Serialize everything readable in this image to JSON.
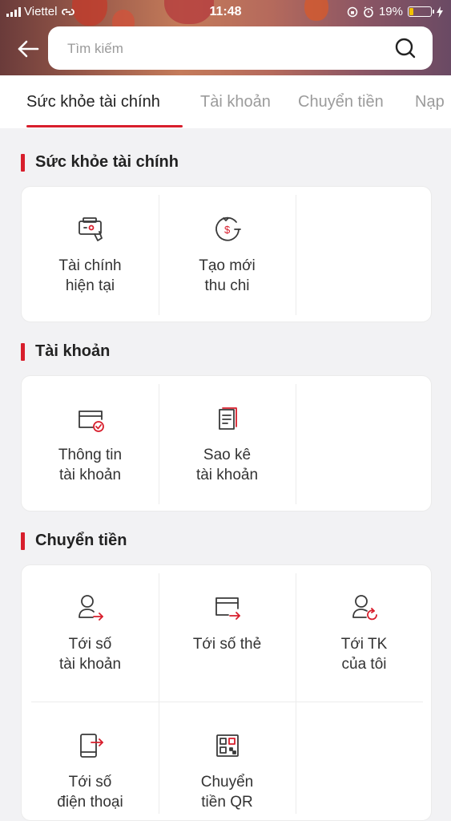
{
  "status_bar": {
    "carrier": "Viettel",
    "time": "11:48",
    "battery": "19%"
  },
  "search": {
    "placeholder": "Tìm kiếm"
  },
  "tabs": [
    {
      "label": "Sức khỏe tài chính",
      "active": true
    },
    {
      "label": "Tài khoản",
      "active": false
    },
    {
      "label": "Chuyển tiền",
      "active": false
    },
    {
      "label": "Nạp",
      "active": false
    }
  ],
  "sections": [
    {
      "title": "Sức khỏe tài chính",
      "items": [
        {
          "label": "Tài chính\nhiện tại",
          "icon": "wallet-hand-icon"
        },
        {
          "label": "Tạo mới\nthu chi",
          "icon": "money-circle-icon"
        }
      ]
    },
    {
      "title": "Tài khoản",
      "items": [
        {
          "label": "Thông tin\ntài khoản",
          "icon": "card-check-icon"
        },
        {
          "label": "Sao kê\ntài khoản",
          "icon": "statement-icon"
        }
      ]
    },
    {
      "title": "Chuyển tiền",
      "items": [
        {
          "label": "Tới số\ntài khoản",
          "icon": "user-transfer-icon"
        },
        {
          "label": "Tới số thẻ",
          "icon": "card-transfer-icon"
        },
        {
          "label": "Tới TK\ncủa tôi",
          "icon": "user-refresh-icon"
        },
        {
          "label": "Tới số\nđiện thoại",
          "icon": "phone-transfer-icon"
        },
        {
          "label": "Chuyển\ntiền QR",
          "icon": "qr-code-icon"
        }
      ]
    }
  ],
  "colors": {
    "accent": "#d81e2c",
    "icon_stroke": "#3a3a3a"
  }
}
